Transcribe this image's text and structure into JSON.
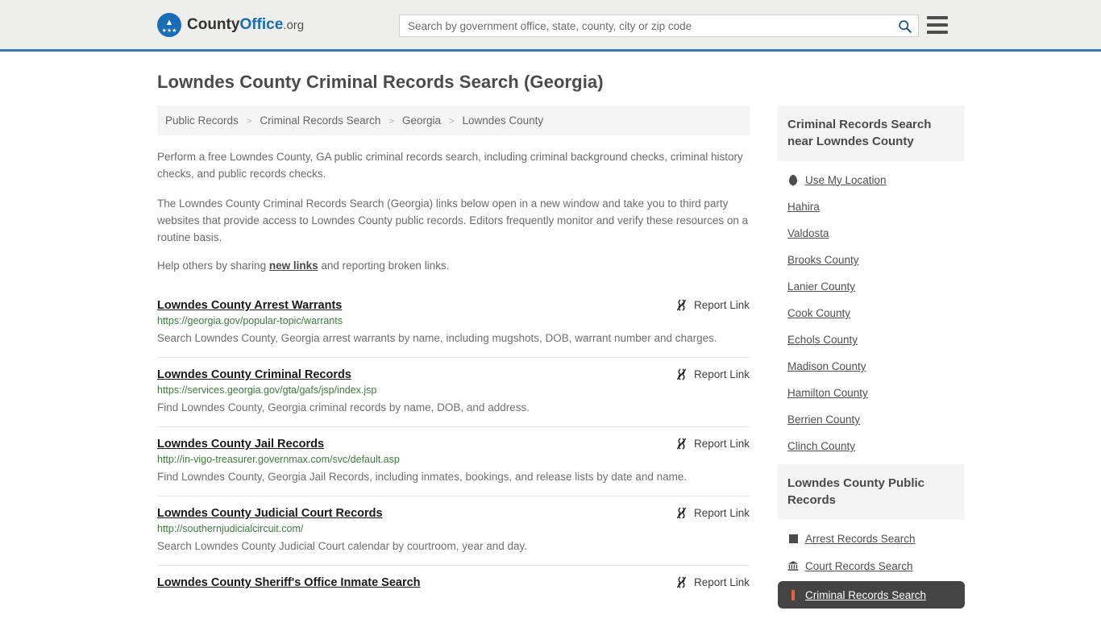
{
  "header": {
    "logo": {
      "part1": "County",
      "part2": "Office",
      "part3": ".org"
    },
    "search": {
      "placeholder": "Search by government office, state, county, city or zip code",
      "value": "",
      "search_icon": "search-icon"
    },
    "menu_icon": "hamburger-menu-icon"
  },
  "page": {
    "title": "Lowndes County Criminal Records Search (Georgia)"
  },
  "breadcrumb": {
    "separator": ">",
    "items": [
      {
        "label": "Public Records"
      },
      {
        "label": "Criminal Records Search"
      },
      {
        "label": "Georgia"
      },
      {
        "label": "Lowndes County"
      }
    ]
  },
  "intro": {
    "p1": "Perform a free Lowndes County, GA public criminal records search, including criminal background checks, criminal history checks, and public records checks.",
    "p2": "The Lowndes County Criminal Records Search (Georgia) links below open in a new window and take you to third party websites that provide access to Lowndes County public records. Editors frequently monitor and verify these resources on a routine basis.",
    "p3_before": "Help others by sharing ",
    "p3_link": "new links",
    "p3_after": " and reporting broken links."
  },
  "results": {
    "report_label": "Report Link",
    "report_icon": "broken-link-icon",
    "items": [
      {
        "title": "Lowndes County Arrest Warrants",
        "url": "https://georgia.gov/popular-topic/warrants",
        "description": "Search Lowndes County, Georgia arrest warrants by name, including mugshots, DOB, warrant number and charges."
      },
      {
        "title": "Lowndes County Criminal Records",
        "url": "https://services.georgia.gov/gta/gafs/jsp/index.jsp",
        "description": "Find Lowndes County, Georgia criminal records by name, DOB, and address."
      },
      {
        "title": "Lowndes County Jail Records",
        "url": "http://in-vigo-treasurer.governmax.com/svc/default.asp",
        "description": "Find Lowndes County, Georgia Jail Records, including inmates, bookings, and release lists by date and name."
      },
      {
        "title": "Lowndes County Judicial Court Records",
        "url": "http://southernjudicialcircuit.com/",
        "description": "Search Lowndes County Judicial Court calendar by courtroom, year and day."
      },
      {
        "title": "Lowndes County Sheriff's Office Inmate Search",
        "url": "",
        "description": ""
      }
    ]
  },
  "sidebar": {
    "nearby": {
      "heading": "Criminal Records Search near Lowndes County",
      "items": [
        {
          "label": "Use My Location",
          "icon": "map-pin-icon"
        },
        {
          "label": "Hahira",
          "icon": ""
        },
        {
          "label": "Valdosta",
          "icon": ""
        },
        {
          "label": "Brooks County",
          "icon": ""
        },
        {
          "label": "Lanier County",
          "icon": ""
        },
        {
          "label": "Cook County",
          "icon": ""
        },
        {
          "label": "Echols County",
          "icon": ""
        },
        {
          "label": "Madison County",
          "icon": ""
        },
        {
          "label": "Hamilton County",
          "icon": ""
        },
        {
          "label": "Berrien County",
          "icon": ""
        },
        {
          "label": "Clinch County",
          "icon": ""
        }
      ]
    },
    "public_records": {
      "heading": "Lowndes County Public Records",
      "items": [
        {
          "label": "Arrest Records Search",
          "icon": "fingerprint-square-icon",
          "active": false
        },
        {
          "label": "Court Records Search",
          "icon": "courthouse-icon",
          "active": false
        },
        {
          "label": "Criminal Records Search",
          "icon": "document-icon",
          "active": true
        }
      ]
    }
  },
  "colors": {
    "header_bg": "#eeeeec",
    "header_border": "#3c78ac",
    "brand_blue": "#1a6cb5",
    "url_green": "#3e7a3e",
    "highlight_bg": "#444444",
    "highlight_accent": "#e8603c"
  }
}
